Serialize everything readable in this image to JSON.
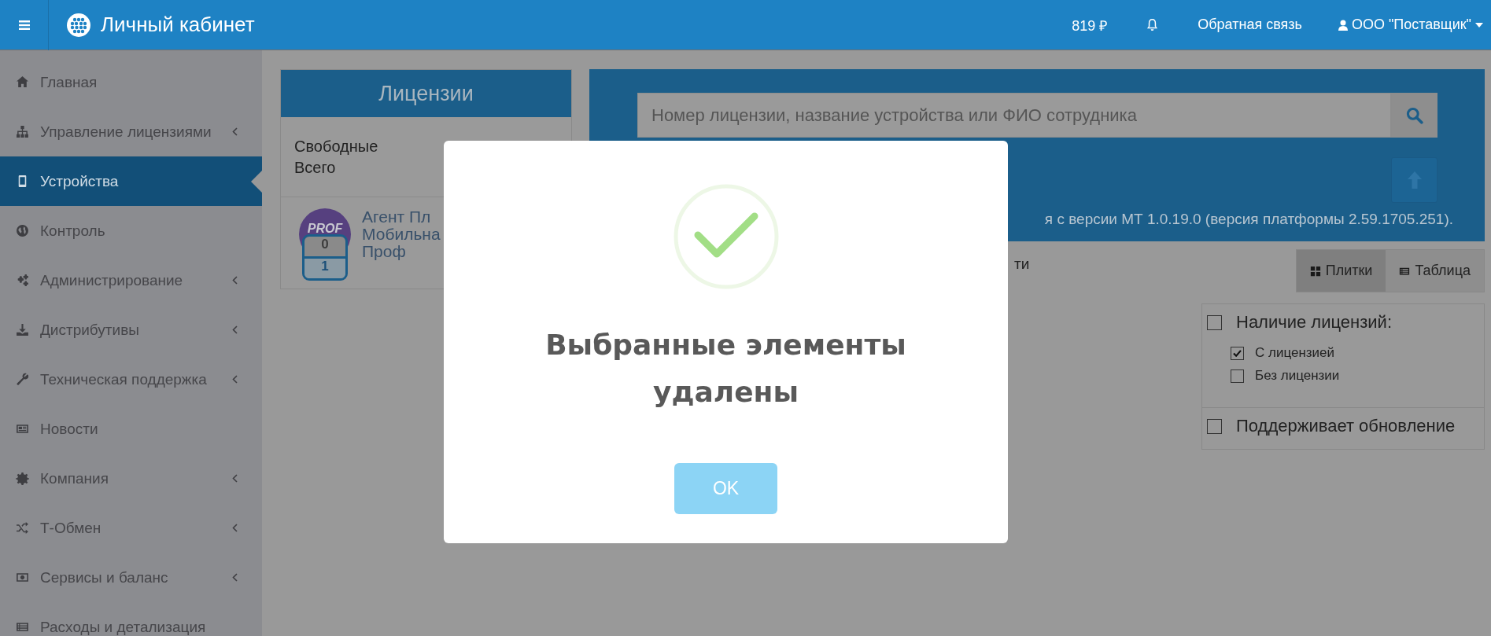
{
  "header": {
    "title": "Личный кабинет",
    "balance": "819 ₽",
    "feedback": "Обратная связь",
    "user": "ООО \"Поставщик\""
  },
  "sidebar": {
    "items": [
      {
        "label": "Главная",
        "has_submenu": false,
        "selected": false
      },
      {
        "label": "Управление лицензиями",
        "has_submenu": true,
        "selected": false
      },
      {
        "label": "Устройства",
        "has_submenu": false,
        "selected": true
      },
      {
        "label": "Контроль",
        "has_submenu": false,
        "selected": false
      },
      {
        "label": "Администрирование",
        "has_submenu": true,
        "selected": false
      },
      {
        "label": "Дистрибутивы",
        "has_submenu": true,
        "selected": false
      },
      {
        "label": "Техническая поддержка",
        "has_submenu": true,
        "selected": false
      },
      {
        "label": "Новости",
        "has_submenu": false,
        "selected": false
      },
      {
        "label": "Компания",
        "has_submenu": true,
        "selected": false
      },
      {
        "label": "Т-Обмен",
        "has_submenu": true,
        "selected": false
      },
      {
        "label": "Сервисы и баланс",
        "has_submenu": true,
        "selected": false
      },
      {
        "label": "Расходы и детализация",
        "has_submenu": false,
        "selected": false
      }
    ]
  },
  "licenses_panel": {
    "title": "Лицензии",
    "summary": [
      "Свободные",
      "Всего"
    ],
    "license": {
      "badge": "PROF",
      "free": "0",
      "total": "1",
      "name_lines": [
        "Агент Пл",
        "Мобильна",
        "Проф"
      ]
    }
  },
  "devices": {
    "search": {
      "placeholder": "Номер лицензии, название устройства или ФИО сотрудника"
    },
    "version_note": "я с версии МТ 1.0.19.0 (версия платформы 2.59.1705.251).",
    "note_fragment": "ти",
    "views": [
      {
        "label": "Плитки",
        "selected": true
      },
      {
        "label": "Таблица",
        "selected": false
      }
    ],
    "filters": [
      {
        "label": "Наличие лицензий:",
        "checked": false,
        "options": [
          {
            "label": "С лицензией",
            "checked": true
          },
          {
            "label": "Без лицензии",
            "checked": false
          }
        ]
      },
      {
        "label": "Поддерживает обновление",
        "checked": false
      }
    ]
  },
  "dialog": {
    "message": "Выбранные элементы удалены",
    "button": "OK"
  }
}
